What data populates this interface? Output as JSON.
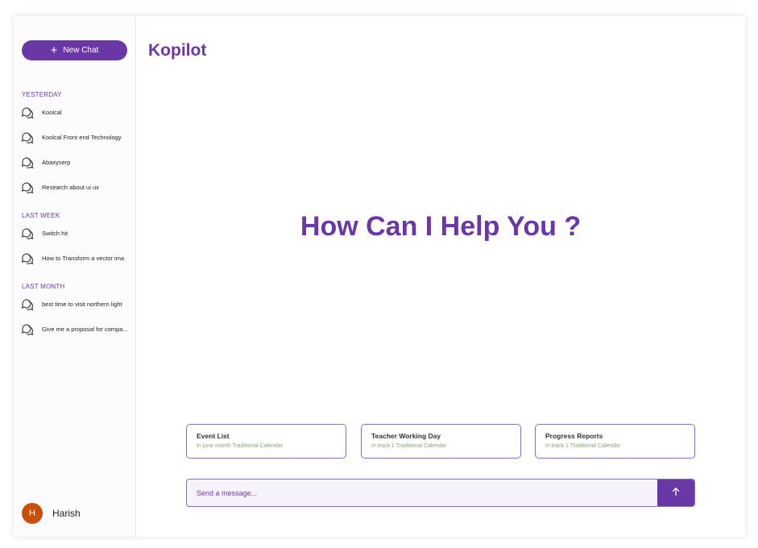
{
  "sidebar": {
    "new_chat_label": "New Chat",
    "new_chat_icon": "plus-icon",
    "sections": [
      {
        "label": "YESTERDAY",
        "items": [
          "Koolcal",
          "Koolcal Front end Technology",
          "Abaxyserp",
          "Research about ui ux"
        ]
      },
      {
        "label": "LAST WEEK",
        "items": [
          "Switch hit",
          "How to Transform a vector ima"
        ]
      },
      {
        "label": "LAST MONTH",
        "items": [
          "best time to visit northern light",
          "Give me a proposal for compa..."
        ]
      }
    ],
    "chat_icon": "chat-bubbles-icon",
    "user": {
      "initial": "H",
      "name": "Harish"
    }
  },
  "main": {
    "app_title": "Kopilot",
    "hero_text": "How Can I Help You ?",
    "suggestions": [
      {
        "title": "Event List",
        "subtitle": "In june month Traditional Calendar"
      },
      {
        "title": "Teacher Working Day",
        "subtitle": "In track 1 Traditional Calendar"
      },
      {
        "title": "Progress Reports",
        "subtitle": "In track 1 Traditional Calendar"
      }
    ],
    "input": {
      "placeholder": "Send a message..."
    },
    "send_icon": "arrow-up-icon"
  },
  "colors": {
    "accent": "#6a38a6",
    "avatar": "#c8500c",
    "subtitle": "#8aa17a"
  }
}
